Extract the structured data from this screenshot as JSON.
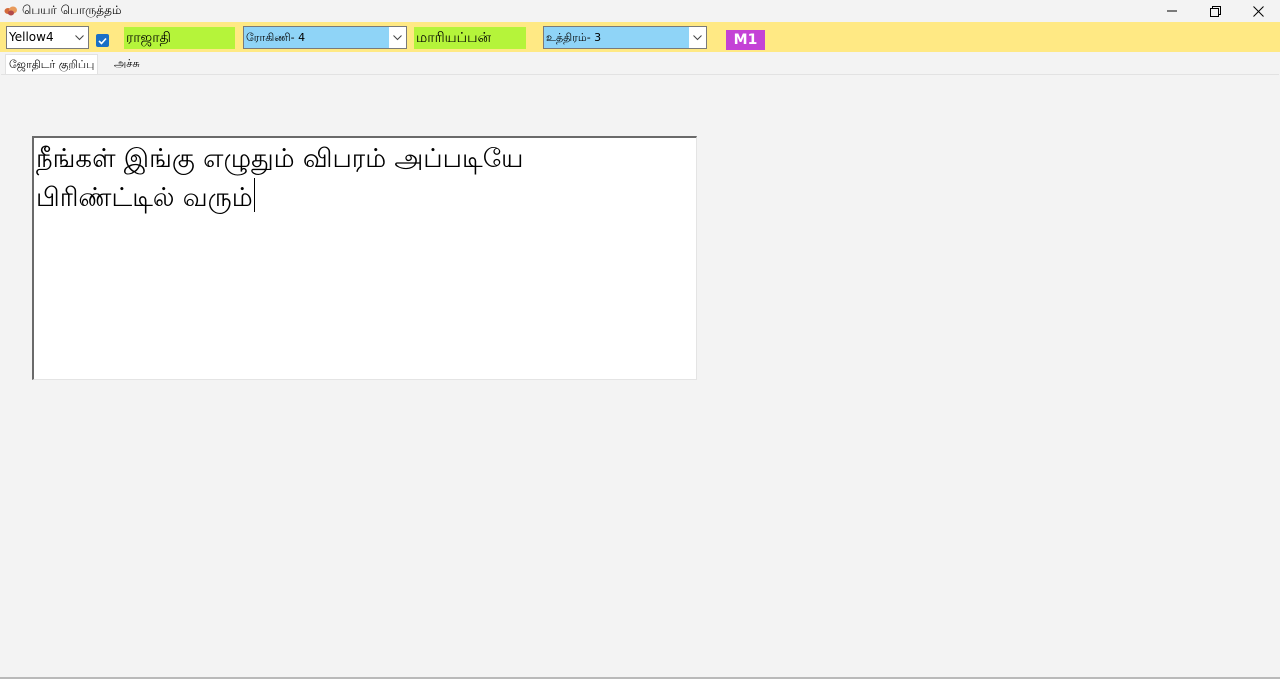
{
  "window": {
    "title": "பெயர் பொருத்தம்"
  },
  "toolbar": {
    "color_select": {
      "value": "Yellow4"
    },
    "checkbox": {
      "checked": true
    },
    "name1": "ராஜாதி",
    "star1_select": {
      "value": "ரோகிணி- 4"
    },
    "name2": "மாரியப்பன்",
    "star2_select": {
      "value": "உத்திரம்- 3"
    },
    "m1_label": "M1"
  },
  "tabs": [
    {
      "label": "ஜோதிடர் குறிப்பு",
      "active": true
    },
    {
      "label": "அச்சு",
      "active": false
    }
  ],
  "notes": {
    "text": "நீங்கள் இங்கு எழுதும் விபரம் அப்படியே\nபிரிண்ட்டில் வரும்"
  },
  "colors": {
    "toolbar_bg": "#ffe984",
    "name_field_bg": "#b5f43a",
    "m1_bg": "#c442d6",
    "checkbox": "#1a6fc6"
  }
}
